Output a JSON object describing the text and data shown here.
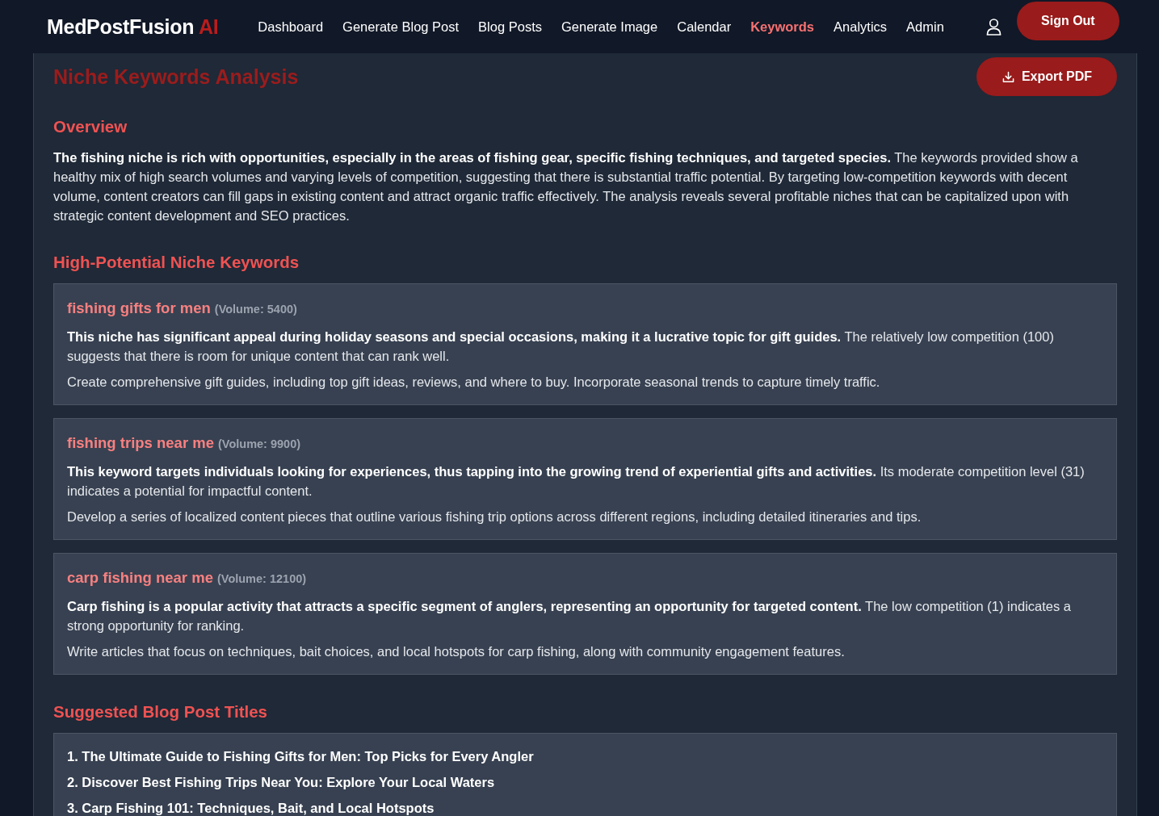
{
  "nav": {
    "brand": "MedPostFusion",
    "brand_accent": "AI",
    "links": [
      {
        "label": "Dashboard",
        "selected": false
      },
      {
        "label": "Generate Blog Post",
        "selected": false
      },
      {
        "label": "Blog Posts",
        "selected": false
      },
      {
        "label": "Generate Image",
        "selected": false
      },
      {
        "label": "Calendar",
        "selected": false
      },
      {
        "label": "Keywords",
        "selected": true
      },
      {
        "label": "Analytics",
        "selected": false
      },
      {
        "label": "Admin",
        "selected": false
      }
    ],
    "sign_out": "Sign Out"
  },
  "page": {
    "title": "Niche Keywords Analysis",
    "export_button": "Export PDF"
  },
  "overview": {
    "heading": "Overview",
    "text": "**The fishing niche is rich with opportunities, especially in the areas of fishing gear, specific fishing techniques, and targeted species.** The keywords provided show a healthy mix of high search volumes and varying levels of competition, suggesting that there is substantial traffic potential. By targeting low-competition keywords with decent volume, content creators can fill gaps in existing content and attract organic traffic effectively. The analysis reveals several profitable niches that can be capitalized upon with strategic content development and SEO practices."
  },
  "keywords": {
    "heading": "High-Potential Niche Keywords",
    "items": [
      {
        "keyword": "fishing gifts for men",
        "volume": "(Volume: 5400)",
        "analysis": "**This niche has significant appeal during holiday seasons and special occasions, making it a lucrative topic for gift guides.** The relatively low competition (100) suggests that there is room for unique content that can rank well.",
        "strategy": "Create comprehensive gift guides, including top gift ideas, reviews, and where to buy. Incorporate seasonal trends to capture timely traffic."
      },
      {
        "keyword": "fishing trips near me",
        "volume": "(Volume: 9900)",
        "analysis": "**This keyword targets individuals looking for experiences, thus tapping into the growing trend of experiential gifts and activities.** Its moderate competition level (31) indicates a potential for impactful content.",
        "strategy": "Develop a series of localized content pieces that outline various fishing trip options across different regions, including detailed itineraries and tips."
      },
      {
        "keyword": "carp fishing near me",
        "volume": "(Volume: 12100)",
        "analysis": "**Carp fishing is a popular activity that attracts a specific segment of anglers, representing an opportunity for targeted content.** The low competition (1) indicates a strong opportunity for ranking.",
        "strategy": "Write articles that focus on techniques, bait choices, and local hotspots for carp fishing, along with community engagement features."
      }
    ]
  },
  "titles": {
    "heading": "Suggested Blog Post Titles",
    "items": [
      "1. The Ultimate Guide to Fishing Gifts for Men: Top Picks for Every Angler",
      "2. Discover Best Fishing Trips Near You: Explore Your Local Waters",
      "3. Carp Fishing 101: Techniques, Bait, and Local Hotspots"
    ]
  }
}
